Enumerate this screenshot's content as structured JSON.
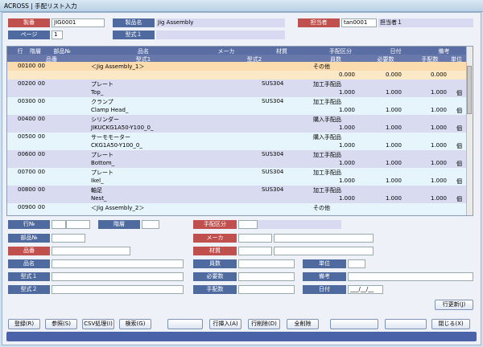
{
  "window_title": "ACROSS | 手配リスト入力",
  "header": {
    "seiban_label": "製番",
    "seiban_value": "JIG0001",
    "seihin_label": "製品名",
    "seihin_value": "Jig Assembly",
    "tanto_label": "担当者",
    "tanto_code": "tan0001",
    "tanto_name": "担当者１",
    "page_label": "ページ",
    "page_value": "1",
    "katashiki_label": "型式１"
  },
  "grid": {
    "headers1": [
      "行",
      "階層",
      "部品№",
      "品名",
      "メーカ",
      "材質",
      "手配区分",
      "日付",
      "備考"
    ],
    "headers2": [
      "品番",
      "型式1",
      "型式2",
      "員数",
      "必要数",
      "手配数",
      "単位"
    ],
    "rows": [
      {
        "gyo": "00100",
        "kaiso": "00",
        "hinmei": "＜Jig Assembly_1＞",
        "katashiki": "",
        "zaishitsu": "",
        "kubun": "その他",
        "insu": "0.000",
        "hitsuyo": "0.000",
        "tehai": "0.000",
        "tani": "",
        "style": "sel",
        "current": true
      },
      {
        "gyo": "00200",
        "kaiso": "00",
        "hinmei": "プレート",
        "katashiki": "Top_",
        "zaishitsu": "SUS304",
        "kubun": "加工手配品",
        "insu": "1.000",
        "hitsuyo": "1.000",
        "tehai": "1.000",
        "tani": "個",
        "style": "alt",
        "current": false
      },
      {
        "gyo": "00300",
        "kaiso": "00",
        "hinmei": "クランプ",
        "katashiki": "Clamp Head_",
        "zaishitsu": "SUS304",
        "kubun": "加工手配品",
        "insu": "1.000",
        "hitsuyo": "1.000",
        "tehai": "1.000",
        "tani": "個",
        "style": "nrm",
        "current": false
      },
      {
        "gyo": "00400",
        "kaiso": "00",
        "hinmei": "シリンダー",
        "katashiki": "JIKUCKG1A50-Y100_0_",
        "zaishitsu": "",
        "kubun": "購入手配品",
        "insu": "1.000",
        "hitsuyo": "1.000",
        "tehai": "1.000",
        "tani": "個",
        "style": "alt",
        "current": false
      },
      {
        "gyo": "00500",
        "kaiso": "00",
        "hinmei": "サーモモーター",
        "katashiki": "CKG1A50-Y100_0_",
        "zaishitsu": "",
        "kubun": "購入手配品",
        "insu": "1.000",
        "hitsuyo": "1.000",
        "tehai": "1.000",
        "tani": "個",
        "style": "nrm",
        "current": false
      },
      {
        "gyo": "00600",
        "kaiso": "00",
        "hinmei": "プレート",
        "katashiki": "Bottom_",
        "zaishitsu": "SUS304",
        "kubun": "加工手配品",
        "insu": "1.000",
        "hitsuyo": "1.000",
        "tehai": "1.000",
        "tani": "個",
        "style": "alt",
        "current": false
      },
      {
        "gyo": "00700",
        "kaiso": "00",
        "hinmei": "プレート",
        "katashiki": "Ikel_",
        "zaishitsu": "SUS304",
        "kubun": "加工手配品",
        "insu": "1.000",
        "hitsuyo": "1.000",
        "tehai": "1.000",
        "tani": "個",
        "style": "nrm",
        "current": false
      },
      {
        "gyo": "00800",
        "kaiso": "00",
        "hinmei": "軸足",
        "katashiki": "Nest_",
        "zaishitsu": "SUS304",
        "kubun": "加工手配品",
        "insu": "1.000",
        "hitsuyo": "1.000",
        "tehai": "1.000",
        "tani": "個",
        "style": "alt",
        "current": false
      },
      {
        "gyo": "00900",
        "kaiso": "00",
        "hinmei": "＜Jig Assembly_2＞",
        "katashiki": "",
        "zaishitsu": "",
        "kubun": "その他",
        "insu": "",
        "hitsuyo": "",
        "tehai": "",
        "tani": "",
        "style": "nrm",
        "current": false
      }
    ]
  },
  "form": {
    "gyo": "行№",
    "kaiso": "階層",
    "tehai_kubun": "手配区分",
    "buhin": "部品№",
    "maker": "メーカ",
    "hinban": "品番",
    "zaishitsu": "材質",
    "hinmei": "品名",
    "insu": "員数",
    "tani": "単位",
    "kata1": "型式１",
    "hitsuyo": "必要数",
    "biko": "備考",
    "kata2": "型式２",
    "tehai_su": "手配数",
    "hizuke": "日付",
    "hizuke_value": "___/__/__",
    "update_btn": "行更新(J)"
  },
  "buttons": [
    "登録(R)",
    "参照(S)",
    "CSV処理(I)",
    "検索(G)",
    "",
    "行挿入(A)",
    "行削除(D)",
    "全削除",
    "",
    "",
    "閉じる(X)"
  ]
}
